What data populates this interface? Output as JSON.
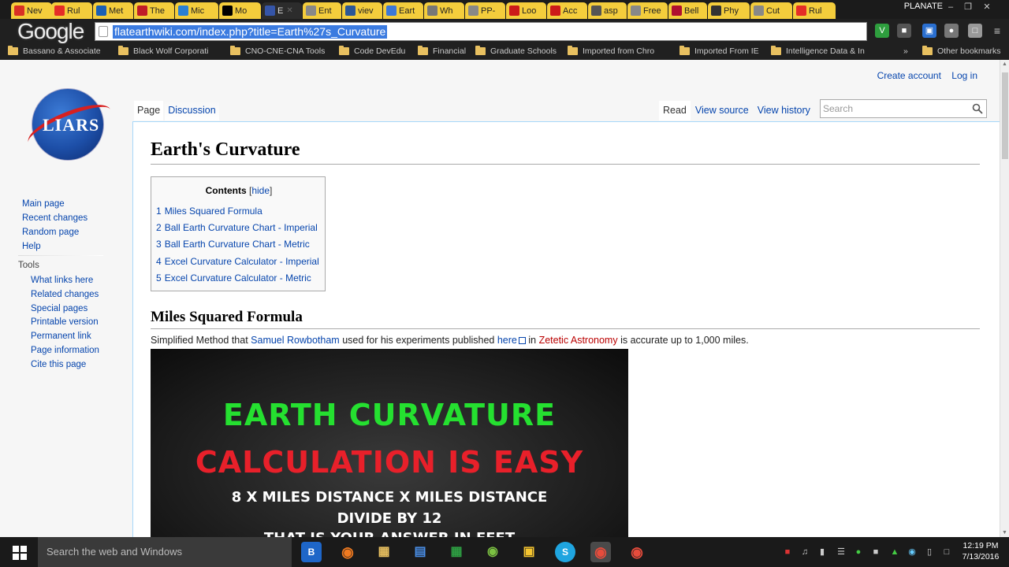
{
  "browser": {
    "tabs": [
      {
        "label": "Nev",
        "icon": "gmail-icon",
        "color": "#d93025"
      },
      {
        "label": "Rul",
        "icon": "youtube-icon",
        "color": "#e52d27"
      },
      {
        "label": "Met",
        "icon": "m-icon",
        "color": "#1a5fb4"
      },
      {
        "label": "The",
        "icon": "r-icon",
        "color": "#c01c28"
      },
      {
        "label": "Mic",
        "icon": "globe-icon",
        "color": "#2a7fd4"
      },
      {
        "label": "Mo",
        "icon": "w-icon",
        "color": "#000000"
      },
      {
        "label": "E",
        "icon": "liars-icon",
        "color": "#3555a8"
      },
      {
        "label": "Ent",
        "icon": "page-icon",
        "color": "#888888"
      },
      {
        "label": "viev",
        "icon": "e-icon",
        "color": "#2b5797"
      },
      {
        "label": "Eart",
        "icon": "doc-icon",
        "color": "#3c78d8"
      },
      {
        "label": "Wh",
        "icon": "web-icon",
        "color": "#777777"
      },
      {
        "label": "PP-",
        "icon": "page-icon",
        "color": "#888888"
      },
      {
        "label": "Loo",
        "icon": "opera-icon",
        "color": "#cc1a1a"
      },
      {
        "label": "Acc",
        "icon": "opera-icon",
        "color": "#cc1a1a"
      },
      {
        "label": "asp",
        "icon": "img-icon",
        "color": "#555555"
      },
      {
        "label": "Free",
        "icon": "page-icon",
        "color": "#888888"
      },
      {
        "label": "Bell",
        "icon": "bell-icon",
        "color": "#b01030"
      },
      {
        "label": "Phy",
        "icon": "aws-icon",
        "color": "#333333"
      },
      {
        "label": "Cut",
        "icon": "page-icon",
        "color": "#888888"
      },
      {
        "label": "Rul",
        "icon": "youtube-icon",
        "color": "#e52d27"
      }
    ],
    "user": "PLANATE",
    "url": "flatearthwiki.com/index.php?title=Earth%27s_Curvature",
    "bookmarks": [
      "Bassano & Associate",
      "Black Wolf Corporati",
      "CNO-CNE-CNA Tools",
      "Code DevEdu",
      "Financial",
      "Graduate Schools",
      "Imported from Chro",
      "Imported From IE",
      "Intelligence Data & In"
    ],
    "bookmarks_more": "»",
    "other_bookmarks": "Other bookmarks"
  },
  "wiki": {
    "personal": {
      "create_account": "Create account",
      "login": "Log in"
    },
    "logo_text": "LIARS",
    "nav": [
      "Main page",
      "Recent changes",
      "Random page",
      "Help"
    ],
    "tools_heading": "Tools",
    "tools": [
      "What links here",
      "Related changes",
      "Special pages",
      "Printable version",
      "Permanent link",
      "Page information",
      "Cite this page"
    ],
    "tabs_left": {
      "page": "Page",
      "discussion": "Discussion"
    },
    "tabs_right": {
      "read": "Read",
      "view_source": "View source",
      "view_history": "View history"
    },
    "search_placeholder": "Search",
    "title": "Earth's Curvature",
    "toc": {
      "title": "Contents",
      "hide": "hide",
      "items": [
        {
          "num": "1",
          "text": "Miles Squared Formula"
        },
        {
          "num": "2",
          "text": "Ball Earth Curvature Chart - Imperial"
        },
        {
          "num": "3",
          "text": "Ball Earth Curvature Chart - Metric"
        },
        {
          "num": "4",
          "text": "Excel Curvature Calculator - Imperial"
        },
        {
          "num": "5",
          "text": "Excel Curvature Calculator - Metric"
        }
      ]
    },
    "section_heading": "Miles Squared Formula",
    "para": {
      "t1": "Simplified Method that ",
      "link1": "Samuel Rowbotham",
      "t2": " used for his experiments published ",
      "link2": "here",
      "t3": " in ",
      "link3": "Zetetic Astronomy",
      "t4": " is accurate up to 1,000 miles."
    },
    "video": {
      "line1": "EARTH CURVATURE",
      "line2": "CALCULATION IS EASY",
      "line3": "8 X MILES DISTANCE X MILES DISTANCE",
      "line4": "DIVIDE BY 12",
      "line5": "THAT IS YOUR ANSWER IN FEET"
    }
  },
  "taskbar": {
    "search_placeholder": "Search the web and Windows",
    "time": "12:19 PM",
    "date": "7/13/2016"
  }
}
